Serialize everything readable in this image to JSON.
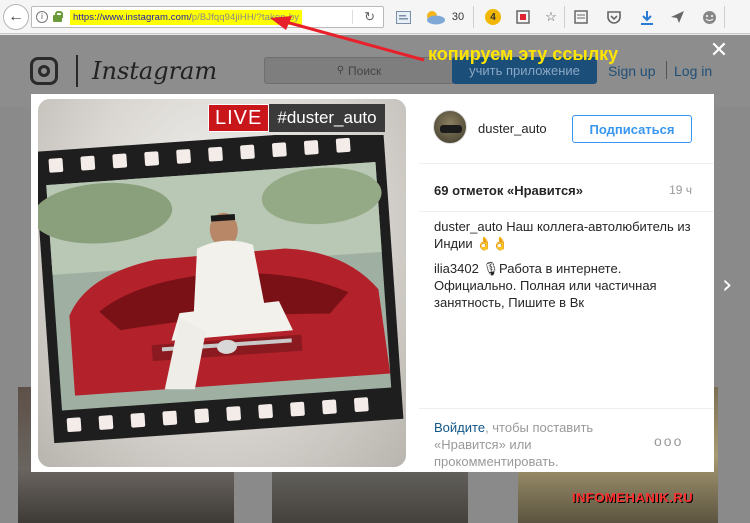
{
  "browser": {
    "url_host": "https://www.instagram.com/",
    "url_path": "p/BJfqq94jiHH/?taken-by",
    "weather_temp": "30",
    "badge_count": "4"
  },
  "instagram": {
    "wordmark": "Instagram",
    "search_placeholder": "Поиск",
    "app_button": "учить приложение",
    "signup": "Sign up",
    "login": "Log in"
  },
  "annotation": {
    "label": "копируем эту ссылку",
    "arrow_color": "#e8202a",
    "label_color": "#ffe600"
  },
  "post": {
    "live_label": "LIVE",
    "hashtag": "#duster_auto",
    "author": "duster_auto",
    "follow_button": "Подписаться",
    "likes": "69 отметок «Нравится»",
    "time": "19 ч",
    "comments": [
      {
        "user": "duster_auto",
        "text": "Наш коллега-автолюбитель из Индии 👌👌"
      },
      {
        "user": "ilia3402",
        "text": "🎙Работа в интернете. Официально. Полная или частичная занятность,  Пишите в Вк"
      }
    ],
    "login_link": "Войдите",
    "login_rest": ", чтобы поставить «Нравится» или прокомментировать.",
    "more": "ooo"
  },
  "watermark": "INFOMEHANIK.RU",
  "icons": [
    "back-arrow-icon",
    "info-icon",
    "lock-icon",
    "reload-icon",
    "reader-icon",
    "weather-icon",
    "badge-icon",
    "bookmark-icon",
    "star-icon",
    "list-icon",
    "pocket-icon",
    "download-icon",
    "send-icon",
    "smile-icon",
    "close-icon",
    "chevron-right-icon"
  ],
  "colors": {
    "accent": "#3897f0",
    "url_highlight": "#ffff00",
    "live_red": "#c9161b"
  }
}
